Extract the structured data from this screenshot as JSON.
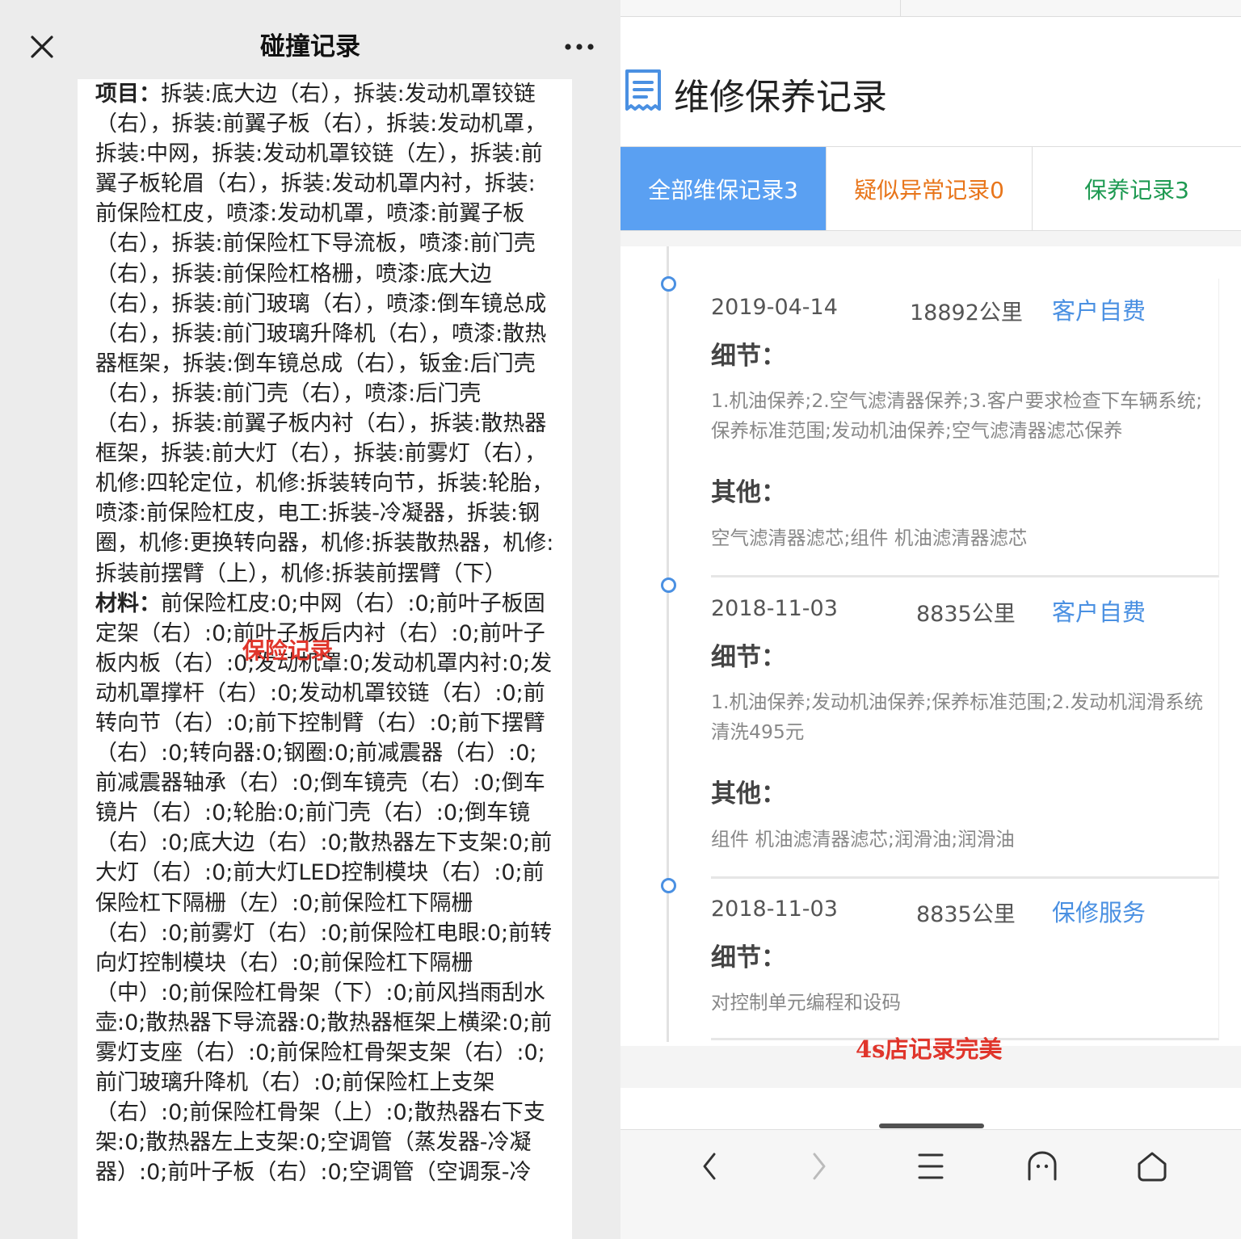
{
  "left_panel": {
    "title": "碰撞记录",
    "projects_label": "项目：",
    "projects_text": "拆装:底大边（右），拆装:发动机罩铰链（右），拆装:前翼子板（右），拆装:发动机罩，拆装:中网，拆装:发动机罩铰链（左），拆装:前翼子板轮眉（右），拆装:发动机罩内衬，拆装:前保险杠皮，喷漆:发动机罩，喷漆:前翼子板（右），拆装:前保险杠下导流板，喷漆:前门壳（右），拆装:前保险杠格栅，喷漆:底大边（右），拆装:前门玻璃（右），喷漆:倒车镜总成（右），拆装:前门玻璃升降机（右），喷漆:散热器框架，拆装:倒车镜总成（右），钣金:后门壳（右），拆装:前门壳（右），喷漆:后门壳（右），拆装:前翼子板内衬（右），拆装:散热器框架，拆装:前大灯（右），拆装:前雾灯（右），机修:四轮定位，机修:拆装转向节，拆装:轮胎，喷漆:前保险杠皮，电工:拆装-冷凝器，拆装:钢圈，机修:更换转向器，机修:拆装散热器，机修:拆装前摆臂（上），机修:拆装前摆臂（下）",
    "insurance_note": "保险记录",
    "materials_label": "材料：",
    "materials_text": "前保险杠皮:0;中网（右）:0;前叶子板固定架（右）:0;前叶子板后内衬（右）:0;前叶子板内板（右）:0;发动机罩:0;发动机罩内衬:0;发动机罩撑杆（右）:0;发动机罩铰链（右）:0;前转向节（右）:0;前下控制臂（右）:0;前下摆臂（右）:0;转向器:0;钢圈:0;前减震器（右）:0;前减震器轴承（右）:0;倒车镜壳（右）:0;倒车镜片（右）:0;轮胎:0;前门壳（右）:0;倒车镜（右）:0;底大边（右）:0;散热器左下支架:0;前大灯（右）:0;前大灯LED控制模块（右）:0;前保险杠下隔栅（左）:0;前保险杠下隔栅（右）:0;前雾灯（右）:0;前保险杠电眼:0;前转向灯控制模块（右）:0;前保险杠下隔栅（中）:0;前保险杠骨架（下）:0;前风挡雨刮水壶:0;散热器下导流器:0;散热器框架上横梁:0;前雾灯支座（右）:0;前保险杠骨架支架（右）:0;前门玻璃升降机（右）:0;前保险杠上支架（右）:0;前保险杠骨架（上）:0;散热器右下支架:0;散热器左上支架:0;空调管（蒸发器-冷凝器）:0;前叶子板（右）:0;空调管（空调泵-冷"
  },
  "right_panel": {
    "section_title": "维修保养记录",
    "tabs": [
      {
        "label": "全部维保记录3",
        "color": "#ffffff",
        "active": true
      },
      {
        "label": "疑似异常记录0",
        "color": "#e8751a"
      },
      {
        "label": "保养记录3",
        "color": "#1e9a52"
      }
    ],
    "detail_label": "细节：",
    "other_label": "其他：",
    "records": [
      {
        "date": "2019-04-14",
        "mileage": "18892公里",
        "type": "客户自费",
        "details": "1.机油保养;2.空气滤清器保养;3.客户要求检查下车辆系统;保养标准范围;发动机油保养;空气滤清器滤芯保养",
        "other": "空气滤清器滤芯;组件 机油滤清器滤芯"
      },
      {
        "date": "2018-11-03",
        "mileage": "8835公里",
        "type": "客户自费",
        "details": "1.机油保养;发动机油保养;保养标准范围;2.发动机润滑系统清洗495元",
        "other": "组件 机油滤清器滤芯;润滑油;润滑油"
      },
      {
        "date": "2018-11-03",
        "mileage": "8835公里",
        "type": "保修服务",
        "details": "对控制单元编程和设码"
      }
    ],
    "annotation": "4s店记录完美"
  },
  "nav_icons": [
    "back-icon",
    "forward-icon",
    "menu-icon",
    "tabs-icon",
    "home-icon"
  ],
  "accent_color": "#4a90e2",
  "annotation_color": "#e0352b"
}
